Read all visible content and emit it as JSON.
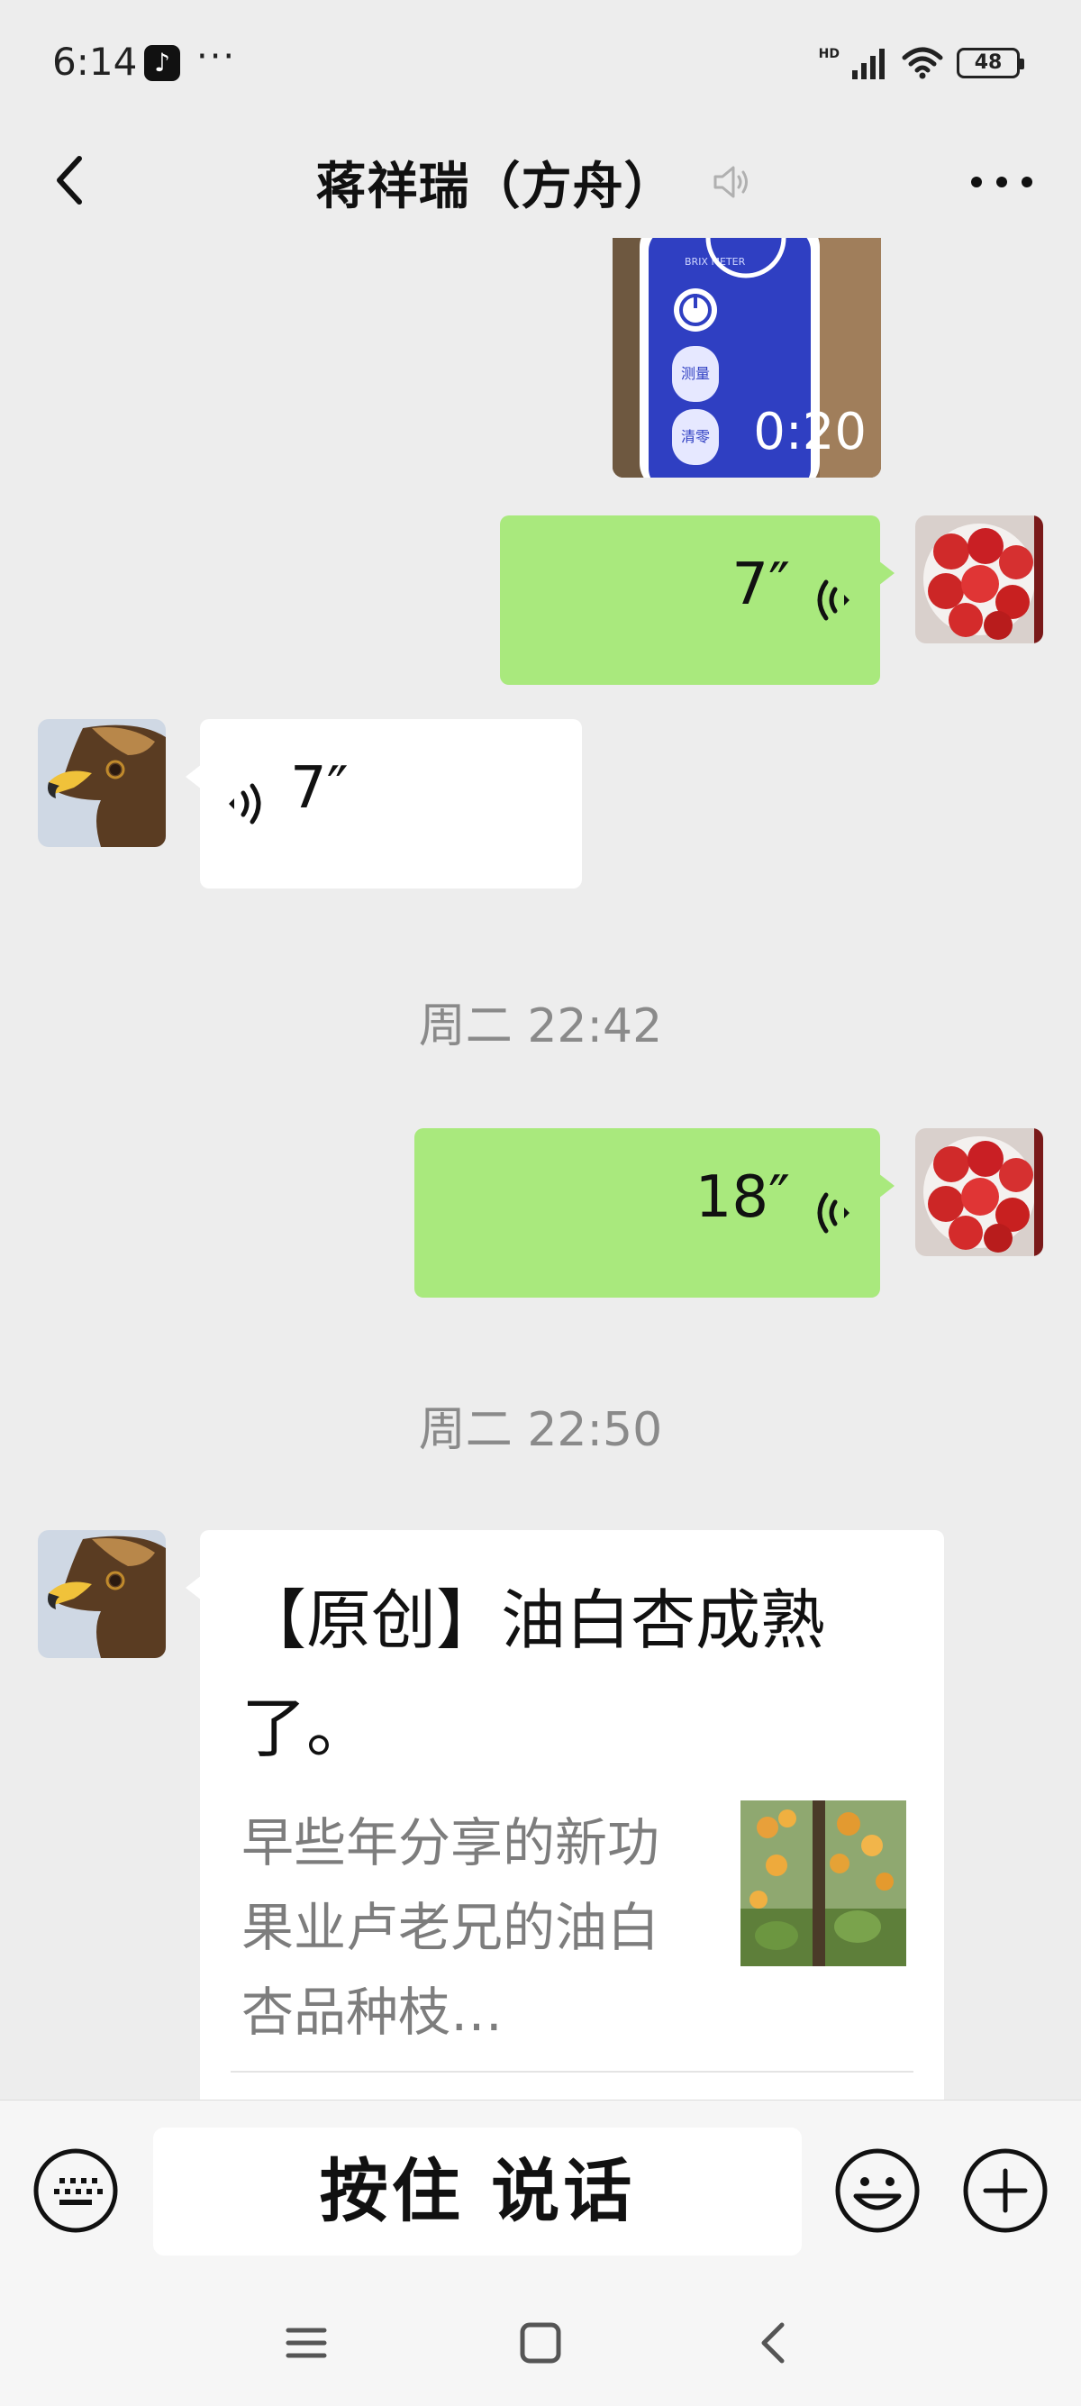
{
  "status_bar": {
    "time": "6:14",
    "app_badge": "♪",
    "more_dots": "···",
    "network": "HD",
    "battery": "48"
  },
  "header": {
    "title": "蒋祥瑞（方舟）"
  },
  "messages": {
    "video": {
      "duration": "0:20"
    },
    "voice_sent_1": {
      "duration": "7″"
    },
    "voice_received_1": {
      "duration": "7″"
    },
    "time_1": "周二 22:42",
    "voice_sent_2": {
      "duration": "18″"
    },
    "time_2": "周二 22:50",
    "article": {
      "title": "【原创】油白杏成熟了。",
      "description": "早些年分享的新功果业卢老兄的油白杏品种枝…"
    }
  },
  "input_bar": {
    "hold_to_talk": "按住 说话"
  },
  "colors": {
    "background": "#ededed",
    "sent_bubble": "#a9e97d",
    "received_bubble": "#ffffff",
    "timestamp_text": "#8a8a8a"
  }
}
